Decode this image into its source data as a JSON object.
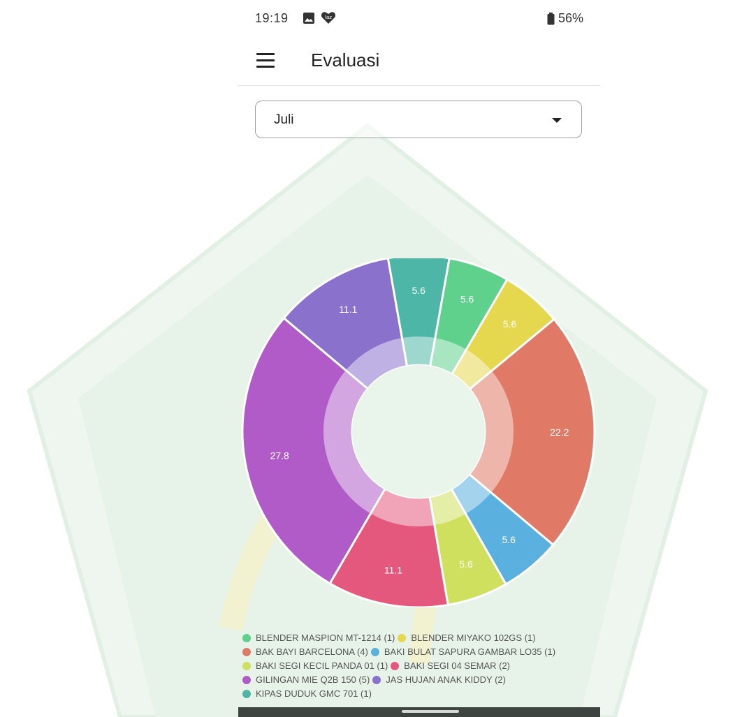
{
  "status_bar": {
    "time": "19:19",
    "battery": "56%",
    "icons": [
      "image-icon",
      "lazada-icon",
      "battery-icon"
    ]
  },
  "app_bar": {
    "title": "Evaluasi",
    "menu_icon": "hamburger-menu-icon"
  },
  "month_select": {
    "selected": "Juli"
  },
  "chart_data": {
    "type": "pie",
    "variant": "donut",
    "title": "",
    "start_angle_deg": -10,
    "slices": [
      {
        "label": "KIPAS DUDUK GMC 701",
        "count": 1,
        "value": 5.6,
        "color": "#4db6a6"
      },
      {
        "label": "BLENDER MASPION MT-1214",
        "count": 1,
        "value": 5.6,
        "color": "#5fd18c"
      },
      {
        "label": "BLENDER MIYAKO 102GS",
        "count": 1,
        "value": 5.6,
        "color": "#e5d84e"
      },
      {
        "label": "BAK BAYI BARCELONA",
        "count": 4,
        "value": 22.2,
        "color": "#e07a66"
      },
      {
        "label": "BAKI BULAT SAPURA GAMBAR LO35",
        "count": 1,
        "value": 5.6,
        "color": "#5ab0de"
      },
      {
        "label": "BAKI SEGI KECIL PANDA 01",
        "count": 1,
        "value": 5.6,
        "color": "#cfe05e"
      },
      {
        "label": "BAKI SEGI 04 SEMAR",
        "count": 2,
        "value": 11.1,
        "color": "#e5587e"
      },
      {
        "label": "GILINGAN MIE Q2B 150",
        "count": 5,
        "value": 27.8,
        "color": "#b05bc8"
      },
      {
        "label": "JAS HUJAN ANAK KIDDY",
        "count": 2,
        "value": 11.1,
        "color": "#8a72cc"
      }
    ]
  },
  "legend": {
    "rows": [
      [
        {
          "text": "BLENDER MASPION MT-1214  (1)",
          "color": "#5fd18c"
        },
        {
          "text": "BLENDER MIYAKO 102GS (1)",
          "color": "#e5d84e"
        }
      ],
      [
        {
          "text": "BAK BAYI BARCELONA (4)",
          "color": "#e07a66"
        },
        {
          "text": "BAKI BULAT SAPURA GAMBAR LO35 (1)",
          "color": "#5ab0de"
        }
      ],
      [
        {
          "text": "BAKI SEGI KECIL PANDA 01 (1)",
          "color": "#cfe05e"
        },
        {
          "text": "BAKI SEGI 04 SEMAR (2)",
          "color": "#e5587e"
        }
      ],
      [
        {
          "text": "GILINGAN MIE Q2B 150 (5)",
          "color": "#b05bc8"
        },
        {
          "text": "JAS HUJAN ANAK KIDDY (2)",
          "color": "#8a72cc"
        }
      ],
      [
        {
          "text": "KIPAS DUDUK GMC 701 (1)",
          "color": "#4db6a6"
        }
      ]
    ]
  }
}
